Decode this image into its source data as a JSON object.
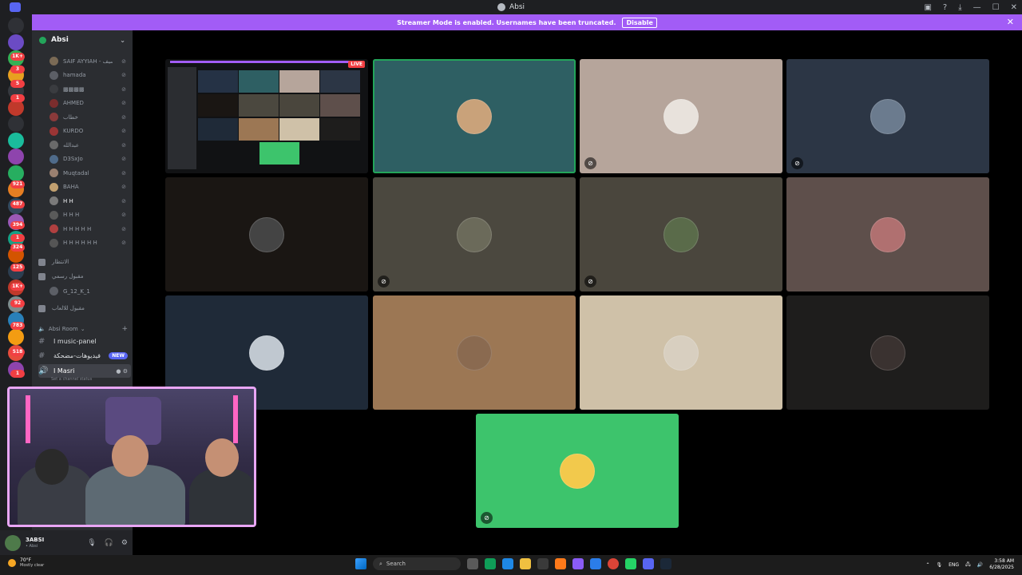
{
  "window": {
    "title": "Absi"
  },
  "banner": {
    "text": "Streamer Mode is enabled. Usernames have been truncated.",
    "button_label": "Disable"
  },
  "rail_badges": [
    "1K+",
    "3",
    "5",
    "1",
    "921",
    "487",
    "1",
    "394",
    "324",
    "125",
    "1K+",
    "92",
    "783",
    "518",
    "1"
  ],
  "guild": {
    "name": "Absi"
  },
  "voice_members": [
    "SAIF AYYIAH - سيف",
    "hamada",
    "▩▩▩▩",
    "AHMED",
    "خطاب",
    "KURDO",
    "عبدالله",
    "D3SxJo",
    "Muqtadal",
    "BAHA",
    "H H",
    "H H H",
    "H H H H H",
    "H H H H H H"
  ],
  "voice_channels": [
    {
      "name": "الانتظار"
    },
    {
      "name": "مقبول رسمي"
    }
  ],
  "sub_member": "G_12_K_1",
  "voice_channel_3": "مقبول للالعاب",
  "category": {
    "name": "Absi Room"
  },
  "text_channels": [
    {
      "name": "I music-panel",
      "new": false
    },
    {
      "name": "فيديوهات-مضحكة",
      "new": true,
      "badge": "NEW"
    },
    {
      "name": "I Masri",
      "new": false,
      "active": true
    }
  ],
  "channel_status": "Set a channel status",
  "user": {
    "name": "3ABSI",
    "sub": "• Absi"
  },
  "screenshare": {
    "live_label": "LIVE"
  },
  "tiles": [
    {
      "id": "t1",
      "bg": "#2e5f63",
      "speaking": true,
      "muted": false
    },
    {
      "id": "t2",
      "bg": "#b6a59b",
      "muted": true
    },
    {
      "id": "t3",
      "bg": "#2c3645",
      "muted": true
    },
    {
      "id": "t4",
      "bg": "#1a1613",
      "muted": false
    },
    {
      "id": "t5",
      "bg": "#4b483f",
      "muted": true
    },
    {
      "id": "t6",
      "bg": "#4a463d",
      "muted": true
    },
    {
      "id": "t7",
      "bg": "#5e4f4b",
      "muted": false
    },
    {
      "id": "t8",
      "bg": "#1f2a38",
      "muted": false
    },
    {
      "id": "t9",
      "bg": "#9c7754",
      "muted": false
    },
    {
      "id": "t10",
      "bg": "#cfc1a8",
      "muted": false
    },
    {
      "id": "t11",
      "bg": "#1e1d1c",
      "muted": false
    },
    {
      "id": "t12",
      "bg": "#3dc46c",
      "muted": true
    }
  ],
  "taskbar": {
    "weather_temp": "70°F",
    "weather_desc": "Mostly clear",
    "search_placeholder": "Search",
    "lang": "ENG",
    "time": "3:58 AM",
    "date": "6/28/2025"
  }
}
